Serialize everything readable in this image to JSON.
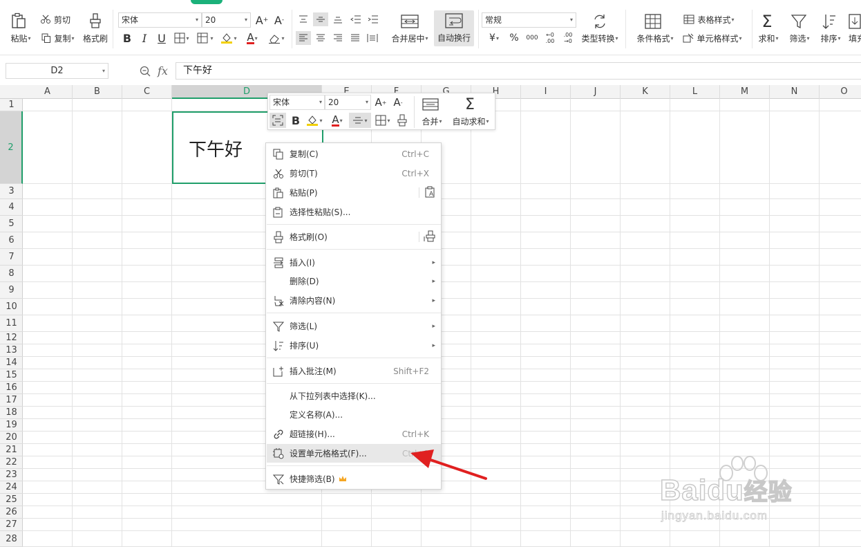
{
  "ribbon": {
    "clipboard": {
      "paste": "粘贴",
      "cut": "剪切",
      "copy": "复制",
      "format_painter": "格式刷"
    },
    "font": {
      "family": "宋体",
      "size": "20"
    },
    "align": {
      "merge_center": "合并居中",
      "wrap_text": "自动换行"
    },
    "number": {
      "format": "常规",
      "currency": "¥",
      "percent": "%",
      "thousands": "000",
      "dec_inc": "←0 .00",
      "dec_dec": ".00 →0",
      "convert": "类型转换"
    },
    "styles": {
      "cond_format": "条件格式",
      "table_style": "表格样式",
      "cell_style": "单元格样式"
    },
    "edit": {
      "sum": "求和",
      "filter": "筛选",
      "sort": "排序",
      "fill": "填充"
    }
  },
  "formula_bar": {
    "name_box": "D2",
    "fx": "fx",
    "content": "下午好"
  },
  "sheet": {
    "columns": [
      "A",
      "B",
      "C",
      "D",
      "E",
      "F",
      "G",
      "H",
      "I",
      "J",
      "K",
      "L",
      "M",
      "N",
      "O"
    ],
    "selected_column": "D",
    "rows": [
      "1",
      "2",
      "3",
      "4",
      "5",
      "6",
      "7",
      "8",
      "9",
      "10",
      "11",
      "12",
      "13",
      "14",
      "15",
      "16",
      "17",
      "18",
      "19",
      "20",
      "21",
      "22",
      "23",
      "24",
      "25",
      "26",
      "27",
      "28"
    ],
    "selected_row": "2",
    "cell_d2": "下午好"
  },
  "mini_toolbar": {
    "font": "宋体",
    "size": "20",
    "bold": "B",
    "merge": "合并",
    "autosum": "自动求和"
  },
  "context_menu": {
    "copy": {
      "label": "复制(C)",
      "shortcut": "Ctrl+C"
    },
    "cut": {
      "label": "剪切(T)",
      "shortcut": "Ctrl+X"
    },
    "paste": {
      "label": "粘贴(P)"
    },
    "paste_special": {
      "label": "选择性粘贴(S)..."
    },
    "format_painter": {
      "label": "格式刷(O)"
    },
    "insert": {
      "label": "插入(I)"
    },
    "delete": {
      "label": "删除(D)"
    },
    "clear": {
      "label": "清除内容(N)"
    },
    "filter": {
      "label": "筛选(L)"
    },
    "sort": {
      "label": "排序(U)"
    },
    "comment": {
      "label": "插入批注(M)",
      "shortcut": "Shift+F2"
    },
    "pick_list": {
      "label": "从下拉列表中选择(K)..."
    },
    "define_name": {
      "label": "定义名称(A)..."
    },
    "hyperlink": {
      "label": "超链接(H)...",
      "shortcut": "Ctrl+K"
    },
    "format_cells": {
      "label": "设置单元格格式(F)...",
      "shortcut": "Ctrl+1"
    },
    "quick_filter": {
      "label": "快捷筛选(B)"
    }
  },
  "watermark": {
    "brand": "Bai",
    "brand2": "du",
    "brand3": "经验",
    "url": "jingyan.baidu.com"
  },
  "colors": {
    "accent": "#1f9e6a",
    "arrow": "#e02020",
    "highlight": "#e8e8e8"
  }
}
